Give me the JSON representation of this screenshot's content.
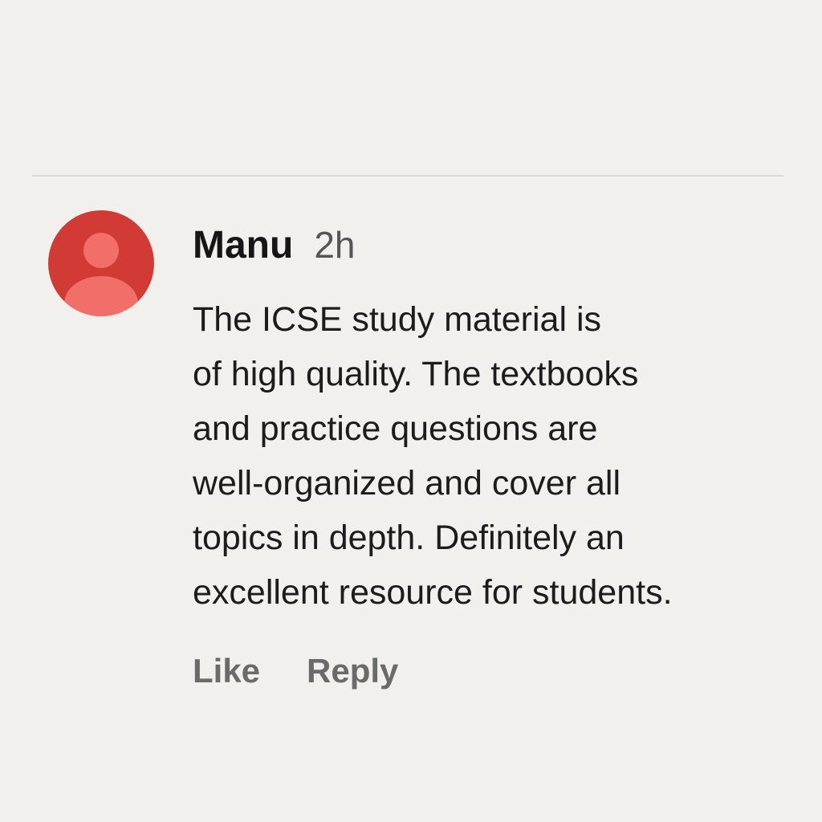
{
  "comment": {
    "author": "Manu",
    "time": "2h",
    "text": "The ICSE study material is\nof high quality. The textbooks\nand practice questions are\nwell-organized and cover all\ntopics in depth. Definitely an\nexcellent resource for students.",
    "avatar_icon": "user-silhouette-icon",
    "avatar_color": "#d23a35",
    "actions": {
      "like_label": "Like",
      "reply_label": "Reply"
    }
  }
}
